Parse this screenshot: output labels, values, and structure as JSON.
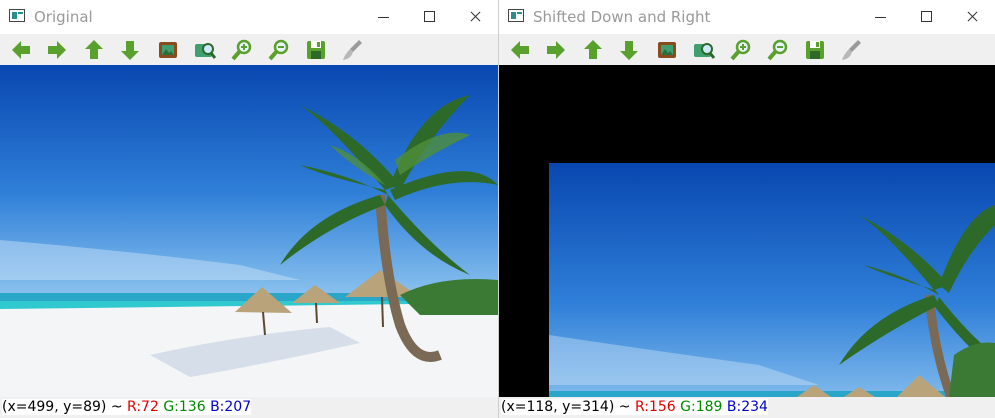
{
  "colors": {
    "toolbar_green": "#5aa02c",
    "sky_top": "#0a4fb4",
    "sky_bottom": "#4f9fe6",
    "sea": "#1fb7c9",
    "sand": "#f4f6f8",
    "status_r": "#e00000",
    "status_g": "#008800",
    "status_b": "#0000cc"
  },
  "toolbar_icons": [
    "arrow-left-icon",
    "arrow-right-icon",
    "arrow-up-icon",
    "arrow-down-icon",
    "save-image-icon",
    "zoom-fit-icon",
    "zoom-in-icon",
    "zoom-out-icon",
    "save-icon",
    "properties-icon"
  ],
  "windows": [
    {
      "title": "Original",
      "status": {
        "coords": "(x=499, y=89) ~",
        "r": "R:72",
        "g": "G:136",
        "b": "B:207"
      }
    },
    {
      "title": "Shifted Down and Right",
      "status": {
        "coords": "(x=118, y=314) ~",
        "r": "R:156",
        "g": "G:189",
        "b": "B:234"
      }
    }
  ]
}
